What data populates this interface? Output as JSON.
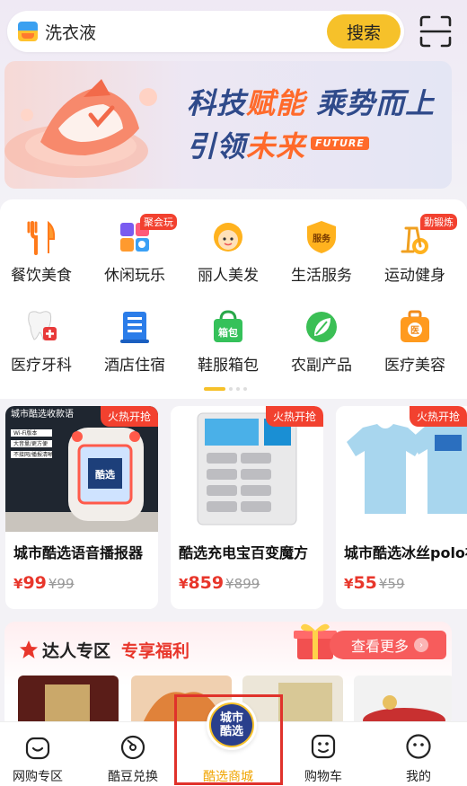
{
  "search": {
    "query": "洗衣液",
    "button_label": "搜索",
    "scan_icon": "scan-icon"
  },
  "banner": {
    "line1_a": "科技",
    "line1_b": "赋能",
    "line1_c": " 乘势而上",
    "line2_a": "引领",
    "line2_b": "未来",
    "future_tag": "FUTURE"
  },
  "categories": [
    {
      "label": "餐饮美食",
      "icon": "fork-knife-icon",
      "tag": ""
    },
    {
      "label": "休闲玩乐",
      "icon": "game-icon",
      "tag": "聚会玩"
    },
    {
      "label": "丽人美发",
      "icon": "beauty-face-icon",
      "tag": ""
    },
    {
      "label": "生活服务",
      "icon": "service-shield-icon",
      "tag": ""
    },
    {
      "label": "运动健身",
      "icon": "bike-icon",
      "tag": "勤锻炼"
    },
    {
      "label": "医疗牙科",
      "icon": "tooth-icon",
      "tag": ""
    },
    {
      "label": "酒店住宿",
      "icon": "hotel-icon",
      "tag": ""
    },
    {
      "label": "鞋服箱包",
      "icon": "bag-icon",
      "tag": ""
    },
    {
      "label": "农副产品",
      "icon": "leaf-icon",
      "tag": ""
    },
    {
      "label": "医疗美容",
      "icon": "medical-kit-icon",
      "tag": ""
    }
  ],
  "category_bag_text": "箱包",
  "category_service_text": "服务",
  "category_medical_text": "医",
  "products": [
    {
      "name": "城市酷选语音播报器",
      "price": "99",
      "old_price": "¥99",
      "hot": "火热开抢",
      "image_title": "城市酷选收款语",
      "image_line1": "Wi-Fi版本",
      "image_line2": "大音量/更方便",
      "image_line3": "不接网/播报清晰",
      "image_screen": "酷选"
    },
    {
      "name": "酷选充电宝百变魔方",
      "price": "859",
      "old_price": "¥899",
      "hot": "火热开抢"
    },
    {
      "name": "城市酷选冰丝polo衫",
      "price": "55",
      "old_price": "¥59",
      "hot": "火热开抢"
    }
  ],
  "currency_symbol": "¥",
  "talent": {
    "title": "达人专区",
    "subtitle": "专享福利",
    "more_label": "查看更多"
  },
  "nav": [
    {
      "label": "网购专区",
      "icon": "smile-bag-icon"
    },
    {
      "label": "酷豆兑换",
      "icon": "bean-icon"
    },
    {
      "label": "酷选商城",
      "icon": "mall-logo-icon"
    },
    {
      "label": "购物车",
      "icon": "cart-face-icon"
    },
    {
      "label": "我的",
      "icon": "profile-face-icon"
    }
  ],
  "center_logo": {
    "line1": "城市",
    "line2": "酷选"
  },
  "colors": {
    "accent_yellow": "#f6c12a",
    "price_red": "#e8362b",
    "tag_red": "#f2412f",
    "banner_blue": "#2f4a8a",
    "banner_orange": "#ff6a2b"
  }
}
